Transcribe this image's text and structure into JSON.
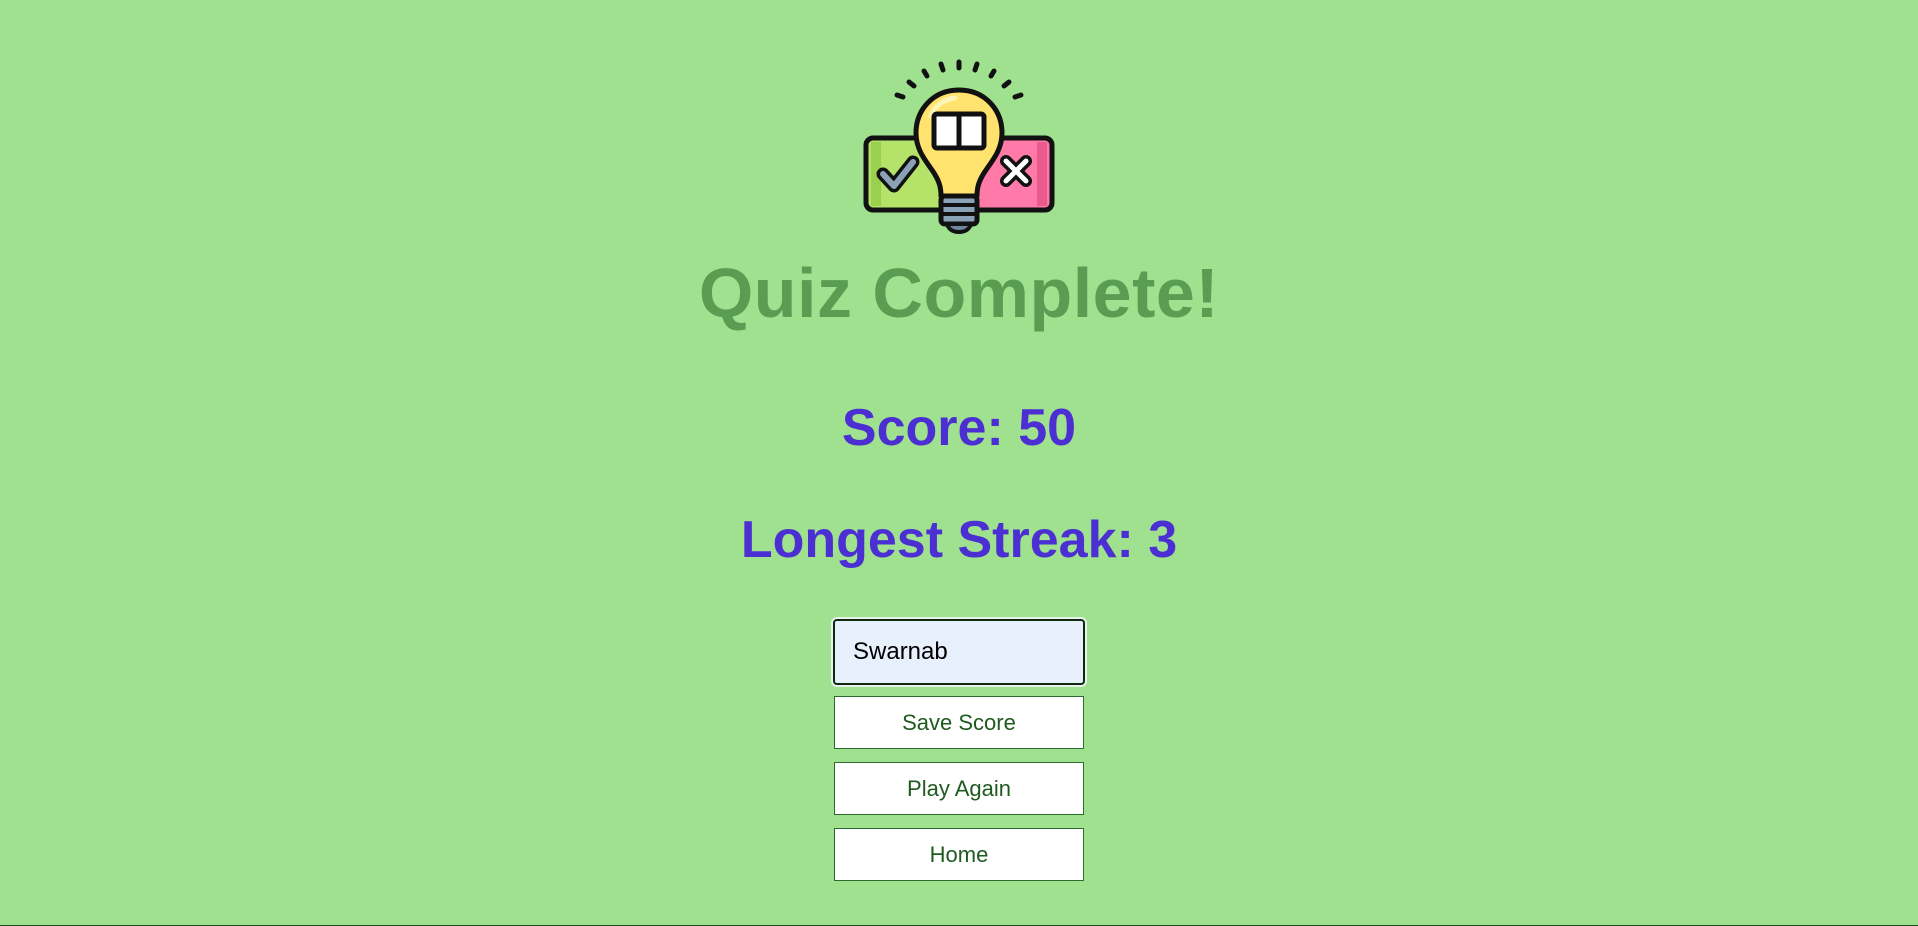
{
  "logo": {
    "icon": "lightbulb-quiz-icon",
    "colors": {
      "check_box": "#b5e36a",
      "x_box": "#ff7aa8",
      "bulb": "#ffe36e",
      "base": "#8aa2b8"
    }
  },
  "title": "Quiz Complete!",
  "score_text": "Score: 50",
  "streak_text": "Longest Streak: 3",
  "name_input": {
    "value": "Swarnab",
    "placeholder": ""
  },
  "buttons": {
    "save": "Save Score",
    "play_again": "Play Again",
    "home": "Home"
  },
  "colors": {
    "background": "#a0e190",
    "title": "#5a9c52",
    "stat_text": "#4b2fd2",
    "button_text": "#1f5a1f"
  }
}
